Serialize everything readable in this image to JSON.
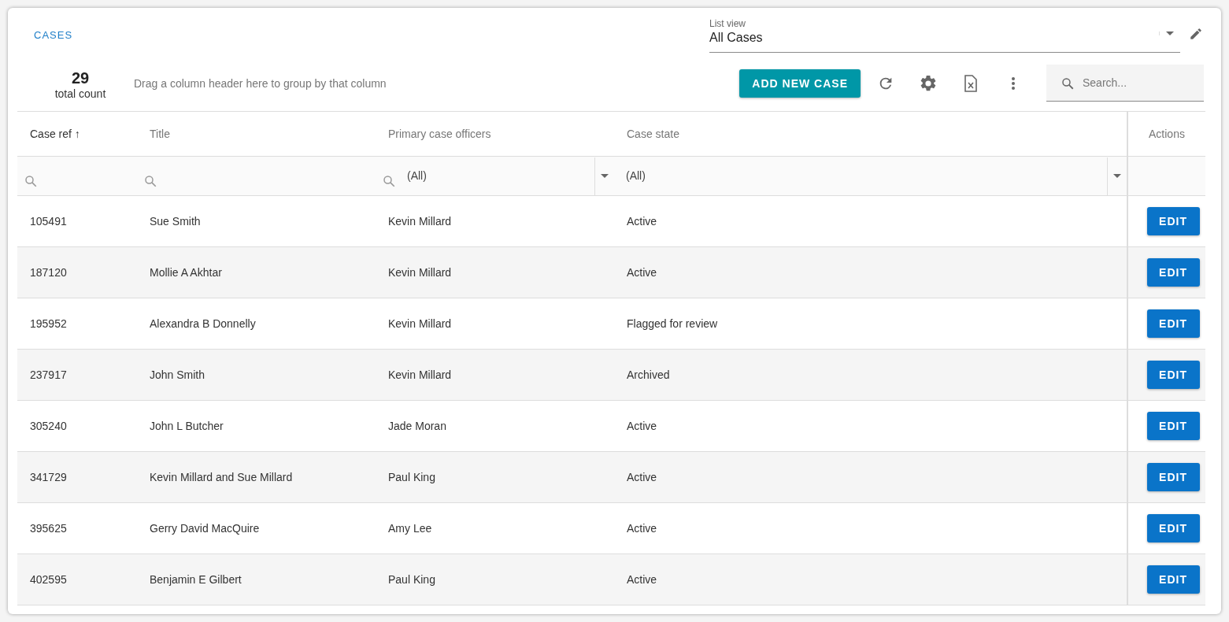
{
  "page_title": "CASES",
  "list_view": {
    "label": "List view",
    "value": "All Cases"
  },
  "summary": {
    "count": "29",
    "count_label": "total count"
  },
  "group_hint": "Drag a column header here to group by that column",
  "toolbar": {
    "add_button": "ADD NEW CASE",
    "search": {
      "placeholder": "Search..."
    }
  },
  "table": {
    "columns": [
      {
        "label": "Case ref",
        "sort_indicator": "↑"
      },
      {
        "label": "Title"
      },
      {
        "label": "Primary case officers"
      },
      {
        "label": "Case state"
      },
      {
        "label": "Actions"
      }
    ],
    "filters": [
      {
        "kind": "search"
      },
      {
        "kind": "search"
      },
      {
        "kind": "select",
        "value": "(All)",
        "icon": true
      },
      {
        "kind": "select",
        "value": "(All)",
        "icon": false
      },
      {
        "kind": "none"
      }
    ],
    "rows": [
      {
        "ref": "105491",
        "title": "Sue Smith",
        "officer": "Kevin Millard",
        "state": "Active",
        "action": "EDIT"
      },
      {
        "ref": "187120",
        "title": "Mollie A Akhtar",
        "officer": "Kevin Millard",
        "state": "Active",
        "action": "EDIT"
      },
      {
        "ref": "195952",
        "title": "Alexandra B Donnelly",
        "officer": "Kevin Millard",
        "state": "Flagged for review",
        "action": "EDIT"
      },
      {
        "ref": "237917",
        "title": "John Smith",
        "officer": "Kevin Millard",
        "state": "Archived",
        "action": "EDIT"
      },
      {
        "ref": "305240",
        "title": "John L Butcher",
        "officer": "Jade Moran",
        "state": "Active",
        "action": "EDIT"
      },
      {
        "ref": "341729",
        "title": "Kevin Millard and Sue Millard",
        "officer": "Paul King",
        "state": "Active",
        "action": "EDIT"
      },
      {
        "ref": "395625",
        "title": "Gerry David MacQuire",
        "officer": "Amy Lee",
        "state": "Active",
        "action": "EDIT"
      },
      {
        "ref": "402595",
        "title": "Benjamin E Gilbert",
        "officer": "Paul King",
        "state": "Active",
        "action": "EDIT"
      }
    ]
  }
}
